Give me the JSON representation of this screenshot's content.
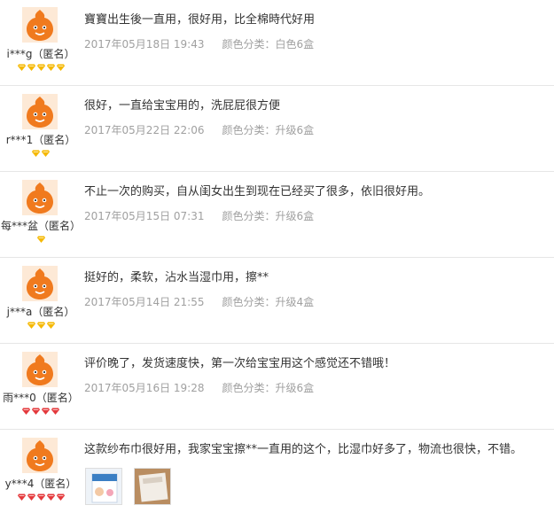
{
  "reviews": [
    {
      "user": "i***g（匿名）",
      "text": "寶寶出生後一直用，很好用，比全棉時代好用",
      "date": "2017年05月18日 19:43",
      "spec": "颜色分类：白色6盒",
      "badges": 5,
      "badge_type": "gold"
    },
    {
      "user": "r***1（匿名）",
      "text": "很好，一直给宝宝用的，洗屁屁很方便",
      "date": "2017年05月22日 22:06",
      "spec": "颜色分类：升级6盒",
      "badges": 2,
      "badge_type": "gold"
    },
    {
      "user": "每***盆（匿名）",
      "text": "不止一次的购买，自从闺女出生到现在已经买了很多，依旧很好用。",
      "date": "2017年05月15日 07:31",
      "spec": "颜色分类：升级6盒",
      "badges": 1,
      "badge_type": "gold"
    },
    {
      "user": "j***a（匿名）",
      "text": "挺好的，柔软，沾水当湿巾用，擦**",
      "date": "2017年05月14日 21:55",
      "spec": "颜色分类：升级4盒",
      "badges": 3,
      "badge_type": "gold"
    },
    {
      "user": "雨***0（匿名）",
      "text": "评价晚了，发货速度快，第一次给宝宝用这个感觉还不错哦！",
      "date": "2017年05月16日 19:28",
      "spec": "颜色分类：升级6盒",
      "badges": 4,
      "badge_type": "red"
    },
    {
      "user": "y***4（匿名）",
      "text": "这款纱布巾很好用，我家宝宝擦**一直用的这个，比湿巾好多了，物流也很快，不错。",
      "date": "",
      "spec": "",
      "badges": 5,
      "badge_type": "red",
      "photos": 2
    }
  ],
  "colors": {
    "gold": "#f5b800",
    "red": "#e4393c",
    "avatar": "#f07a1e",
    "meta": "#a0a0a0"
  },
  "icons": {
    "avatar": "orange-mascot-avatar-icon",
    "badge": "diamond-badge-icon",
    "photo": "review-photo-thumbnail"
  }
}
